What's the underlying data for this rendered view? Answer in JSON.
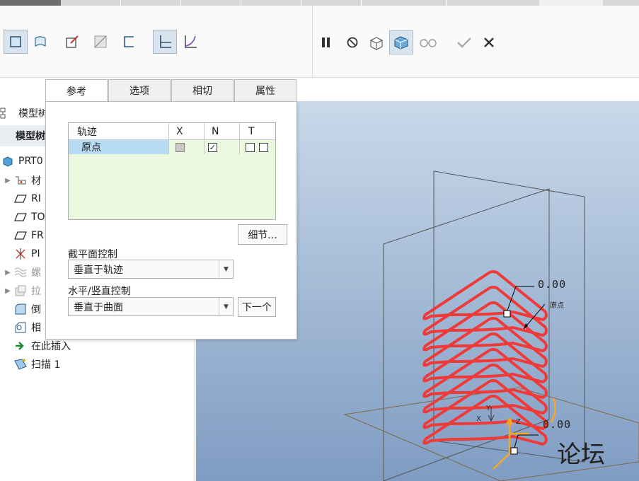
{
  "tabs": [
    {
      "label": "参考",
      "active": true
    },
    {
      "label": "选项",
      "active": false
    },
    {
      "label": "相切",
      "active": false
    },
    {
      "label": "属性",
      "active": false
    }
  ],
  "model_tree": {
    "header": "模型树",
    "subheader": "模型树",
    "items": [
      {
        "label": "PRT0",
        "icon": "part-icon"
      },
      {
        "label": "材",
        "icon": "material-icon"
      },
      {
        "label": "RI",
        "icon": "datum-plane-icon"
      },
      {
        "label": "TO",
        "icon": "datum-plane-icon"
      },
      {
        "label": "FR",
        "icon": "datum-plane-icon"
      },
      {
        "label": "PI",
        "icon": "coordinate-system-icon"
      },
      {
        "label": "螺",
        "icon": "helix-icon"
      },
      {
        "label": "拉",
        "icon": "extrude-icon"
      },
      {
        "label": "倒",
        "icon": "round-icon"
      },
      {
        "label": "相",
        "icon": "chamfer-icon"
      },
      {
        "label": "在此插入",
        "icon": "insert-here-icon"
      },
      {
        "label": "扫描 1",
        "icon": "sweep-icon"
      }
    ]
  },
  "references": {
    "columns": [
      "轨迹",
      "X",
      "N",
      "T"
    ],
    "rows": [
      {
        "name": "原点",
        "x": "grey",
        "n": "checked",
        "t": [
          "unchecked",
          "unchecked"
        ]
      }
    ],
    "details_button": "细节...",
    "section_plane_label": "截平面控制",
    "section_plane_value": "垂直于轨迹",
    "orientation_label": "水平/竖直控制",
    "orientation_value": "垂直于曲面",
    "next_button": "下一个"
  },
  "viewport": {
    "dim_top": "0.00",
    "dim_bottom": "0.00",
    "origin_label": "原点",
    "csys_x": "X",
    "csys_y": "Y",
    "csys_z": "Z",
    "watermark": "论坛"
  },
  "colors": {
    "trajectory": "#f03a3a",
    "viewport_top": "#c9d9ea",
    "viewport_bottom": "#7f9cc2",
    "table_bg": "#eaf8de",
    "selected_row": "#b6dcf5"
  }
}
